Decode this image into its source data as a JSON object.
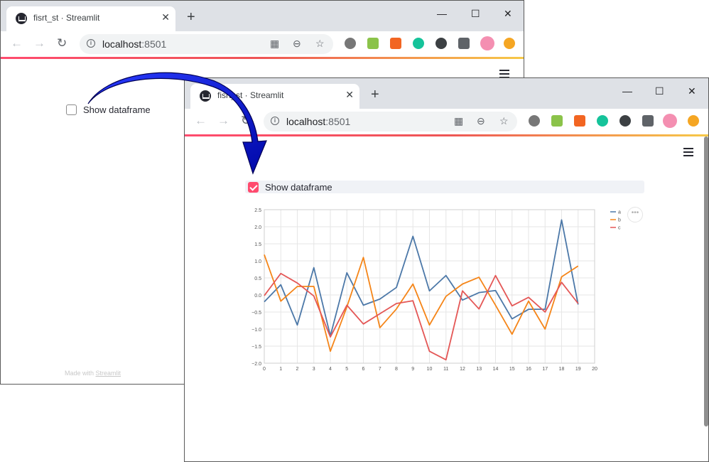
{
  "browser": {
    "tab_title": "fisrt_st · Streamlit",
    "url_host": "localhost",
    "url_port": ":8501",
    "new_tab": "+",
    "close": "✕",
    "minimize": "—",
    "maximize": "☐",
    "win_close": "✕"
  },
  "app": {
    "checkbox_label": "Show dataframe",
    "footer_prefix": "Made with ",
    "footer_link": "Streamlit"
  },
  "colors": {
    "accent": "#ff4b6e",
    "arrow": "#0a14c8"
  },
  "chart_data": {
    "type": "line",
    "x": [
      0,
      1,
      2,
      3,
      4,
      5,
      6,
      7,
      8,
      9,
      10,
      11,
      12,
      13,
      14,
      15,
      16,
      17,
      18,
      19
    ],
    "series": [
      {
        "name": "a",
        "color": "#4c78a8",
        "values": [
          -0.2,
          0.3,
          -0.88,
          0.8,
          -1.2,
          0.65,
          -0.3,
          -0.12,
          0.22,
          1.72,
          0.12,
          0.57,
          -0.15,
          0.07,
          0.13,
          -0.7,
          -0.42,
          -0.42,
          2.2,
          -0.28
        ]
      },
      {
        "name": "b",
        "color": "#f58518",
        "values": [
          1.18,
          -0.18,
          0.25,
          0.25,
          -1.65,
          -0.35,
          1.1,
          -0.96,
          -0.41,
          0.32,
          -0.88,
          -0.04,
          0.32,
          0.52,
          -0.3,
          -1.15,
          -0.18,
          -1.0,
          0.53,
          0.85
        ]
      },
      {
        "name": "c",
        "color": "#e45756",
        "values": [
          -0.02,
          0.63,
          0.35,
          -0.03,
          -1.23,
          -0.3,
          -0.85,
          -0.55,
          -0.25,
          -0.17,
          -1.65,
          -1.9,
          0.12,
          -0.41,
          0.57,
          -0.32,
          -0.07,
          -0.5,
          0.37,
          -0.25
        ]
      }
    ],
    "xlim": [
      0,
      20
    ],
    "ylim": [
      -2.0,
      2.5
    ],
    "xticks": [
      "0",
      "1",
      "2",
      "3",
      "4",
      "5",
      "6",
      "7",
      "8",
      "9",
      "10",
      "11",
      "12",
      "13",
      "14",
      "15",
      "16",
      "17",
      "18",
      "19",
      "20"
    ],
    "yticks": [
      "2.5",
      "2.0",
      "1.5",
      "1.0",
      "0.5",
      "0.0",
      "−0.5",
      "−1.0",
      "−1.5",
      "−2.0"
    ],
    "grid": true,
    "legend": "top-right",
    "menu": "•••"
  }
}
